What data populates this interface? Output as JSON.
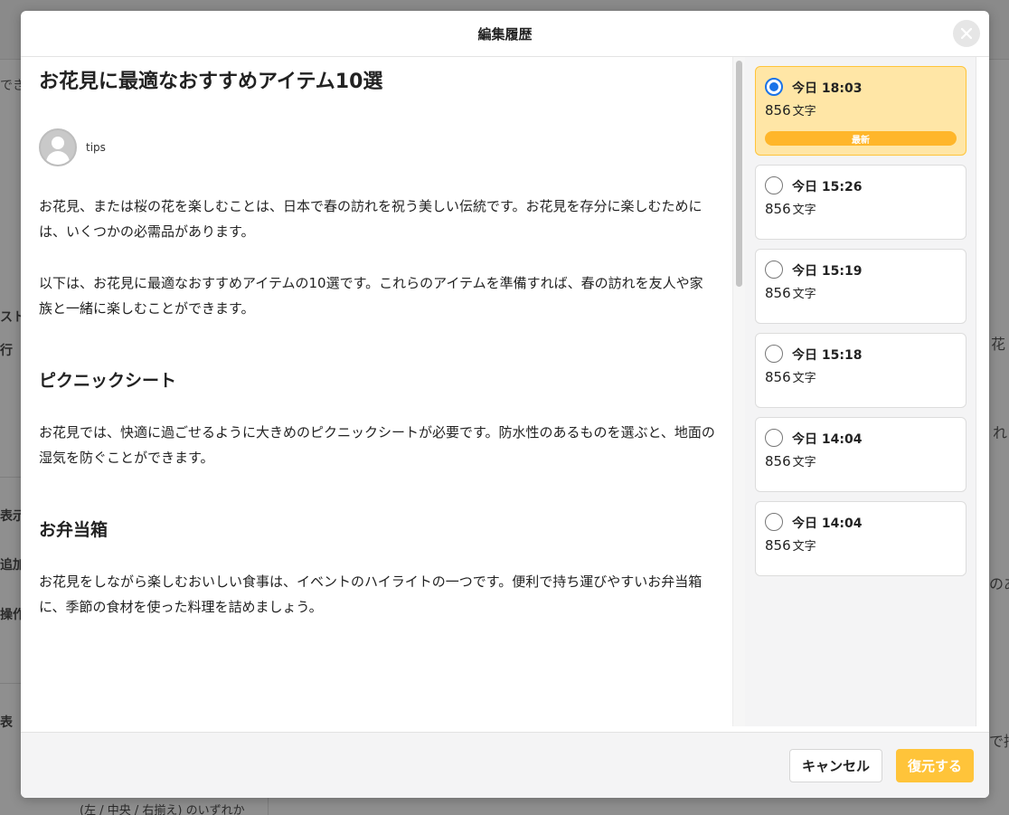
{
  "background": {
    "left_fragments": [
      "できる",
      "スト",
      "行",
      "表示",
      "追加",
      "操作",
      "表"
    ],
    "right_fragments": [
      "花",
      "れ",
      "のあ",
      "で持"
    ],
    "bottom_caption": "(左 / 中央 / 右揃え) のいずれか"
  },
  "modal": {
    "title": "編集履歴",
    "close_icon": "close-icon"
  },
  "article": {
    "title": "お花見に最適なおすすめアイテム10選",
    "author": "tips",
    "paragraphs": {
      "intro1": "お花見、または桜の花を楽しむことは、日本で春の訪れを祝う美しい伝統です。お花見を存分に楽しむためには、いくつかの必需品があります。",
      "intro2": "以下は、お花見に最適なおすすめアイテムの10選です。これらのアイテムを準備すれば、春の訪れを友人や家族と一緒に楽しむことができます。",
      "picnic": "お花見では、快適に過ごせるように大きめのピクニックシートが必要です。防水性のあるものを選ぶと、地面の湿気を防ぐことができます。",
      "bento": "お花見をしながら楽しむおいしい食事は、イベントのハイライトの一つです。便利で持ち運びやすいお弁当箱に、季節の食材を使った料理を詰めましょう。"
    },
    "sections": {
      "picnic": "ピクニックシート",
      "bento": "お弁当箱"
    }
  },
  "history": {
    "unit": "文字",
    "latest_label": "最新",
    "items": [
      {
        "time": "今日 18:03",
        "count": "856"
      },
      {
        "time": "今日 15:26",
        "count": "856"
      },
      {
        "time": "今日 15:19",
        "count": "856"
      },
      {
        "time": "今日 15:18",
        "count": "856"
      },
      {
        "time": "今日 14:04",
        "count": "856"
      },
      {
        "time": "今日 14:04",
        "count": "856"
      }
    ]
  },
  "footer": {
    "cancel_label": "キャンセル",
    "restore_label": "復元する"
  },
  "colors": {
    "accent": "#ffc43a",
    "selected_bg": "#ffe6a6",
    "radio_selected": "#1a73e8"
  }
}
